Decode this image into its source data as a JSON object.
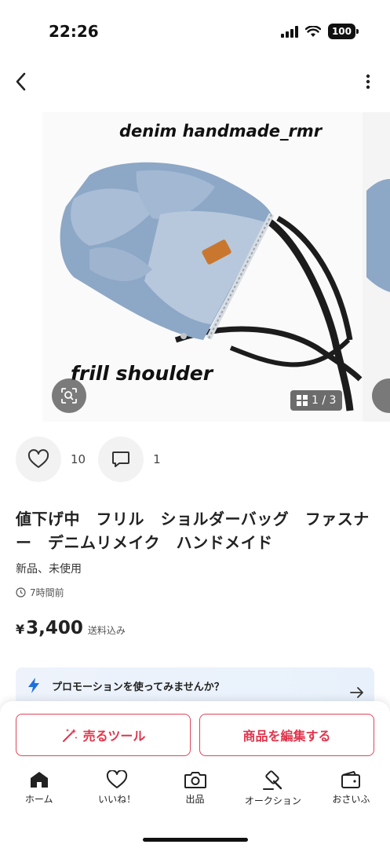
{
  "status_bar": {
    "time": "22:26",
    "battery": "100"
  },
  "product": {
    "photo_caption_top": "denim handmade_rmr",
    "photo_caption_bottom": "frill shoulder",
    "image_counter": "1 / 3",
    "likes": "10",
    "comments": "1",
    "title": "値下げ中　フリル　ショルダーバッグ　ファスナー　デニムリメイク　ハンドメイド",
    "condition": "新品、未使用",
    "posted": "7時間前",
    "price_currency": "¥",
    "price": "3,400",
    "shipping": "送料込み"
  },
  "promotion": {
    "text": "プロモーションを使ってみませんか？"
  },
  "actions": {
    "sell_tool": "売るツール",
    "edit": "商品を編集する"
  },
  "tabs": [
    {
      "label": "ホーム",
      "icon": "home-icon"
    },
    {
      "label": "いいね！",
      "icon": "heart-icon"
    },
    {
      "label": "出品",
      "icon": "camera-icon"
    },
    {
      "label": "オークション",
      "icon": "gavel-icon"
    },
    {
      "label": "おさいふ",
      "icon": "wallet-icon"
    }
  ],
  "colors": {
    "accent": "#e0354c",
    "promo_bg": "#eef3fb",
    "bolt": "#1f6fe0"
  }
}
